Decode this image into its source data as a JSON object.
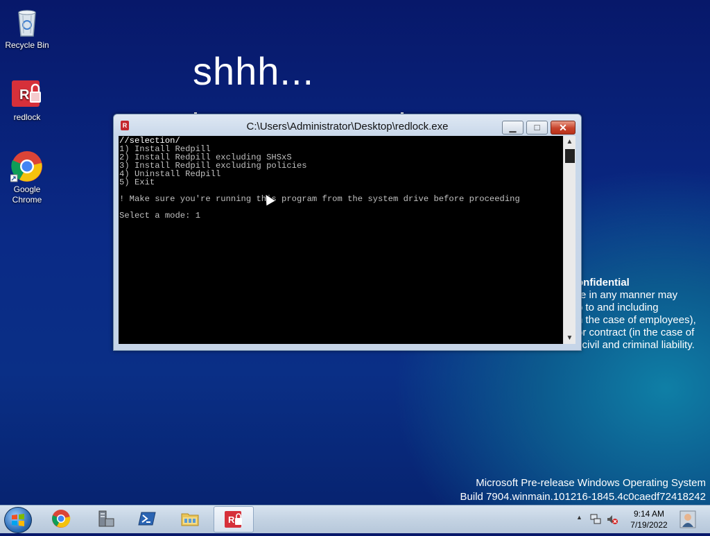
{
  "desktop": {
    "icons": [
      {
        "label": "Recycle Bin"
      },
      {
        "label": "redlock"
      },
      {
        "label": "Google Chrome"
      }
    ],
    "headline": "shhh...",
    "confidential": {
      "title": "onfidential",
      "lines": [
        "re in any manner may",
        "o to and including",
        "n the case of employees),",
        "or contract (in the case of",
        "l civil and criminal liability."
      ]
    },
    "watermark": {
      "line1": "Microsoft Pre-release Windows Operating System",
      "line2": "Build 7904.winmain.101216-1845.4c0caedf72418242"
    }
  },
  "window": {
    "title": "C:\\Users\\Administrator\\Desktop\\redlock.exe",
    "app_icon": "R",
    "minimize_symbol": "▁",
    "maximize_symbol": "□",
    "close_symbol": "✕",
    "console_lines": [
      "//selection/",
      "1) Install Redpill",
      "2) Install Redpill excluding SHSxS",
      "3) Install Redpill excluding policies",
      "4) Uninstall Redpill",
      "5) Exit",
      "",
      "! Make sure you're running this program from the system drive before proceeding",
      "",
      "Select a mode: 1"
    ],
    "scroll_up": "▲",
    "scroll_down": "▼"
  },
  "taskbar": {
    "items": [
      {
        "name": "chrome"
      },
      {
        "name": "server-manager"
      },
      {
        "name": "powershell"
      },
      {
        "name": "explorer"
      },
      {
        "name": "redlock"
      }
    ],
    "time": "9:14 AM",
    "date": "7/19/2022",
    "tray_expand": "▲"
  }
}
